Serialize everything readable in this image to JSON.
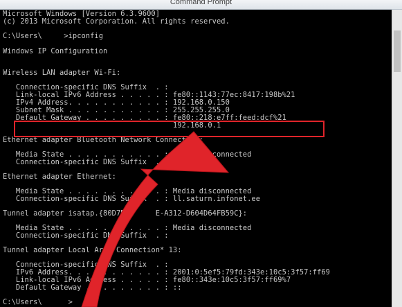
{
  "window": {
    "title": "Command Prompt"
  },
  "console": {
    "lines": [
      "Microsoft Windows [Version 6.3.9600]",
      "(c) 2013 Microsoft Corporation. All rights reserved.",
      "",
      "C:\\Users\\     >ipconfig",
      "",
      "Windows IP Configuration",
      "",
      "",
      "Wireless LAN adapter Wi-Fi:",
      "",
      "   Connection-specific DNS Suffix  . :",
      "   Link-local IPv6 Address . . . . . : fe80::1143:77ec:8417:198b%21",
      "   IPv4 Address. . . . . . . . . . . : 192.168.0.150",
      "   Subnet Mask . . . . . . . . . . . : 255.255.255.0",
      "   Default Gateway . . . . . . . . . : fe80::218:e7ff:feed:dcf%21",
      "                                       192.168.0.1",
      "",
      "Ethernet adapter Bluetooth Network Connection:",
      "",
      "   Media State . . . . . . . . . . . : Media disconnected",
      "   Connection-specific DNS Suffix  . :",
      "",
      "Ethernet adapter Ethernet:",
      "",
      "   Media State . . . . . . . . . . . : Media disconnected",
      "   Connection-specific DNS Suffix  . : ll.saturn.infonet.ee",
      "",
      "Tunnel adapter isatap.{80D7B8F     E-A312-D604D64FB59C}:",
      "",
      "   Media State . . . . . . . . . . . : Media disconnected",
      "   Connection-specific DNS Suffix  . :",
      "",
      "Tunnel adapter Local Area Connection* 13:",
      "",
      "   Connection-specific DNS Suffix  . :",
      "   IPv6 Address. . . . . . . . . . . : 2001:0:5ef5:79fd:343e:10c5:3f57:ff69",
      "   Link-local IPv6 Address . . . . . : fe80::343e:10c5:3f57:ff69%7",
      "   Default Gateway . . . . . . . . . : ::",
      "",
      "C:\\Users\\      >"
    ]
  },
  "colors": {
    "text": "#c9c9c9",
    "background": "#000000",
    "highlight": "#e0242a",
    "arrow": "#e0242a"
  },
  "annotation": {
    "arrow_icon": "curved-arrow-icon"
  }
}
